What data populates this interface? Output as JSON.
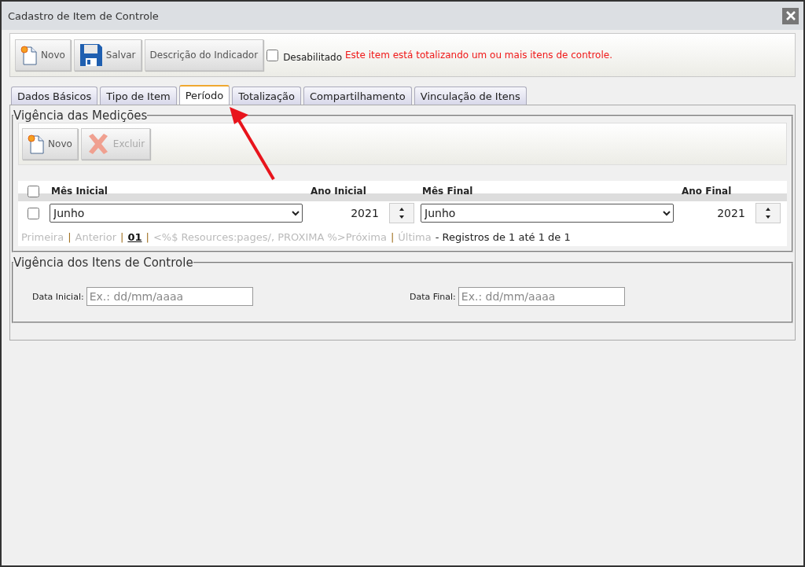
{
  "window": {
    "title": "Cadastro de Item de Controle"
  },
  "toolbar": {
    "buttons": [
      {
        "label": "Novo",
        "kind": "new"
      },
      {
        "label": "Salvar",
        "kind": "save"
      },
      {
        "label": "Descrição do Indicador",
        "kind": "text"
      }
    ],
    "disabled_checkbox": {
      "label": "Desabilitado",
      "checked": false
    },
    "warning": "Este item está totalizando um ou mais itens de controle."
  },
  "tabs": [
    {
      "label": "Dados Básicos",
      "selected": false
    },
    {
      "label": "Tipo de Item",
      "selected": false
    },
    {
      "label": "Período",
      "selected": true
    },
    {
      "label": "Totalização",
      "selected": false
    },
    {
      "label": "Compartilhamento",
      "selected": false
    },
    {
      "label": "Vinculação de Itens",
      "selected": false
    }
  ],
  "measurements": {
    "legend": "Vigência das Medições",
    "buttons": [
      {
        "label": "Novo",
        "kind": "new",
        "disabled": false
      },
      {
        "label": "Excluir",
        "kind": "delete",
        "disabled": true
      }
    ],
    "select_all_checked": false,
    "columns": [
      "Mês Inicial",
      "Ano Inicial",
      "Mês Final",
      "Ano Final"
    ],
    "rows": [
      {
        "checked": false,
        "start_month": "Junho",
        "start_year": "2021",
        "end_month": "Junho",
        "end_year": "2021"
      }
    ],
    "pager": [
      {
        "kind": "link",
        "text": "Primeira",
        "disabled": true
      },
      {
        "kind": "sep",
        "text": "|"
      },
      {
        "kind": "link",
        "text": "Anterior",
        "disabled": true
      },
      {
        "kind": "sep",
        "text": "|"
      },
      {
        "kind": "page",
        "text": "01",
        "disabled": false
      },
      {
        "kind": "sep",
        "text": "|"
      },
      {
        "kind": "link",
        "text": "<%$ Resources:pages/, PROXIMA %>Próxima",
        "disabled": true
      },
      {
        "kind": "sep",
        "text": "|"
      },
      {
        "kind": "link",
        "text": "Última",
        "disabled": true
      },
      {
        "kind": "info",
        "text": "- Registros de 1 até 1 de 1"
      }
    ]
  },
  "control_items": {
    "legend": "Vigência dos Itens de Controle",
    "fields": [
      {
        "label": "Data Inicial:",
        "placeholder": "Ex.: dd/mm/aaaa"
      },
      {
        "label": "Data Final:",
        "placeholder": "Ex.: dd/mm/aaaa"
      }
    ]
  }
}
